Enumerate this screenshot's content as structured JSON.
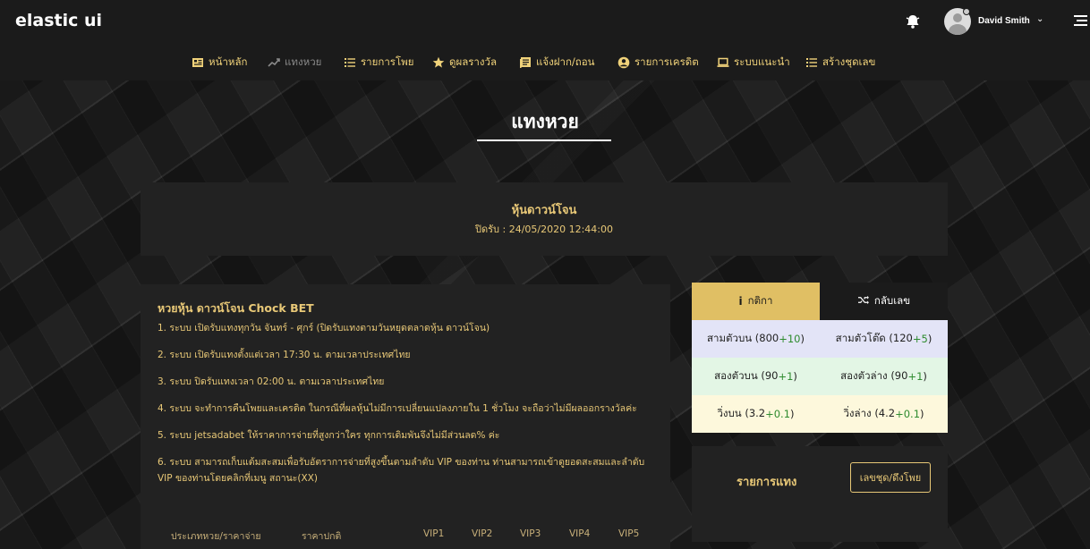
{
  "app": {
    "logo": "elastic ui"
  },
  "user": {
    "name": "David Smith"
  },
  "nav": [
    {
      "label": "หน้าหลัก",
      "icon": "home-grid-icon"
    },
    {
      "label": "แทงหวย",
      "icon": "chart-line-icon"
    },
    {
      "label": "รายการโพย",
      "icon": "list-icon"
    },
    {
      "label": "ดูผลรางวัล",
      "icon": "star-icon"
    },
    {
      "label": "แจ้งฝาก/ถอน",
      "icon": "book-icon"
    },
    {
      "label": "รายการเครดิต",
      "icon": "user-circle-icon"
    },
    {
      "label": "ระบบแนะนำ",
      "icon": "laptop-icon"
    },
    {
      "label": "สร้างชุดเลข",
      "icon": "list-check-icon"
    }
  ],
  "page": {
    "title": "แทงหวย"
  },
  "lottery": {
    "name": "หุ้นดาวน์โจน",
    "close_time": "ปิดรับ : 24/05/2020 12:44:00"
  },
  "rules": {
    "title": "หวยหุ้น ดาวน์โจน Chock BET",
    "items": [
      "1. ระบบ เปิดรับแทงทุกวัน จันทร์ - ศุกร์ (ปิดรับแทงตามวันหยุดตลาดหุ้น ดาวน์โจน)",
      "2. ระบบ เปิดรับแทงตั้งแต่เวลา 17:30 น. ตามเวลาประเทศไทย",
      "3. ระบบ ปิดรับแทงเวลา 02:00 น. ตามเวลาประเทศไทย",
      "4. ระบบ จะทำการคืนโพยและเครดิต ในกรณีที่ผลหุ้นไม่มีการเปลี่ยนแปลงภายใน 1 ชั่วโมง จะถือว่าไม่มีผลออกรางวัลค่ะ",
      "5. ระบบ jetsadabet ให้ราคาการจ่ายที่สูงกว่าใคร ทุกการเดิมพันจึงไม่มีส่วนลด% ค่ะ",
      "6. ระบบ สามารถเก็บแต้มสะสมเพื่อรับอัตราการจ่ายที่สูงขึ้นตามลำดับ VIP ของท่าน ท่านสามารถเข้าดูยอดสะสมและลำดับ VIP ของท่านโดยคลิกที่เมนู สถานะ(XX)"
    ]
  },
  "table": {
    "headers": [
      "ประเภทหวย/ราคาจ่าย",
      "ราคาปกติ",
      "VIP1",
      "VIP2",
      "VIP3",
      "VIP4",
      "VIP5"
    ]
  },
  "tabs": {
    "rules": "กติกา",
    "flip": "กลับเลข"
  },
  "rates": [
    {
      "left": {
        "label": "สามตัวบน (800",
        "plus": "+10",
        "close": ")"
      },
      "right": {
        "label": "สามตัวโต๊ด (120",
        "plus": "+5",
        "close": ")"
      },
      "bg": "#e3e4f7"
    },
    {
      "left": {
        "label": "สองตัวบน (90",
        "plus": "+1",
        "close": ")"
      },
      "right": {
        "label": "สองตัวล่าง (90",
        "plus": "+1",
        "close": ")"
      },
      "bg": "#e3f6e5"
    },
    {
      "left": {
        "label": "วิ่งบน (3.2",
        "plus": "+0.1",
        "close": ")"
      },
      "right": {
        "label": "วิ่งล่าง (4.2",
        "plus": "+0.1",
        "close": ")"
      },
      "bg": "#fdf8dc"
    }
  ],
  "bets": {
    "label": "รายการแทง",
    "button": "เลขชุด/ดึงโพย"
  },
  "colors": {
    "accent": "#e0bf64",
    "gold_text": "#e8c877",
    "dark": "#1b1b1b",
    "panel": "#222222",
    "plus": "#2e8b2e"
  }
}
